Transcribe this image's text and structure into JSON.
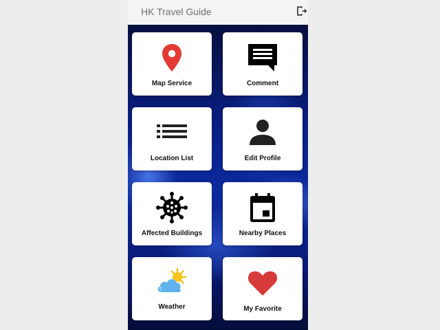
{
  "appbar": {
    "title": "HK Travel Guide",
    "logout_icon": "logout-icon"
  },
  "menu": [
    {
      "label": "Map Service",
      "icon": "map-pin-icon",
      "color": "#e53935"
    },
    {
      "label": "Comment",
      "icon": "comment-icon",
      "color": "#000000"
    },
    {
      "label": "Location List",
      "icon": "list-icon",
      "color": "#222222"
    },
    {
      "label": "Edit Profile",
      "icon": "person-icon",
      "color": "#222222"
    },
    {
      "label": "Affected Buildings",
      "icon": "virus-icon",
      "color": "#000000"
    },
    {
      "label": "Nearby Places",
      "icon": "calendar-icon",
      "color": "#000000"
    },
    {
      "label": "Weather",
      "icon": "cloud-sun-icon",
      "color": "#4aa8e8"
    },
    {
      "label": "My Favorite",
      "icon": "heart-icon",
      "color": "#d63a3a"
    }
  ],
  "colors": {
    "background_top": "#06103f",
    "background_mid": "#0c2a9e",
    "card": "#ffffff",
    "appbar": "#f4f4f4"
  }
}
